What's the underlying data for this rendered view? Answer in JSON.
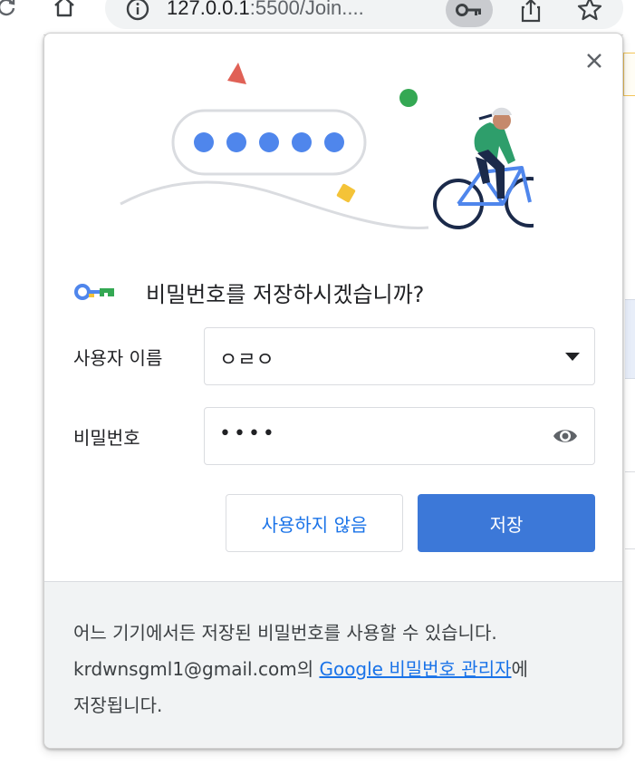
{
  "browser": {
    "url_host": "127.0.0.1",
    "url_rest": ":5500/Join...."
  },
  "dialog": {
    "title": "비밀번호를 저장하시겠습니까?",
    "username": {
      "label": "사용자 이름",
      "value": "ㅇㄹㅇ"
    },
    "password": {
      "label": "비밀번호",
      "value": "••••"
    },
    "buttons": {
      "never": "사용하지 않음",
      "save": "저장"
    },
    "footer": {
      "line1": "어느 기기에서든 저장된 비밀번호를 사용할 수 있습니다.",
      "account": "krdwnsgml1@gmail.com",
      "connector": "의 ",
      "link": "Google 비밀번호 관리자",
      "suffix": "에",
      "line3": "저장됩니다."
    }
  },
  "colors": {
    "accent": "#1a73e8",
    "primary_button": "#3c78d8",
    "dot_blue": "#4f86ec",
    "triangle": "#e06156",
    "dot_green": "#34a853",
    "diamond": "#f4c338"
  },
  "icons": [
    "reload-icon",
    "home-icon",
    "info-icon",
    "key-icon",
    "share-icon",
    "star-icon",
    "close-icon",
    "password-key-icon",
    "dropdown-arrow-icon",
    "eye-icon"
  ]
}
